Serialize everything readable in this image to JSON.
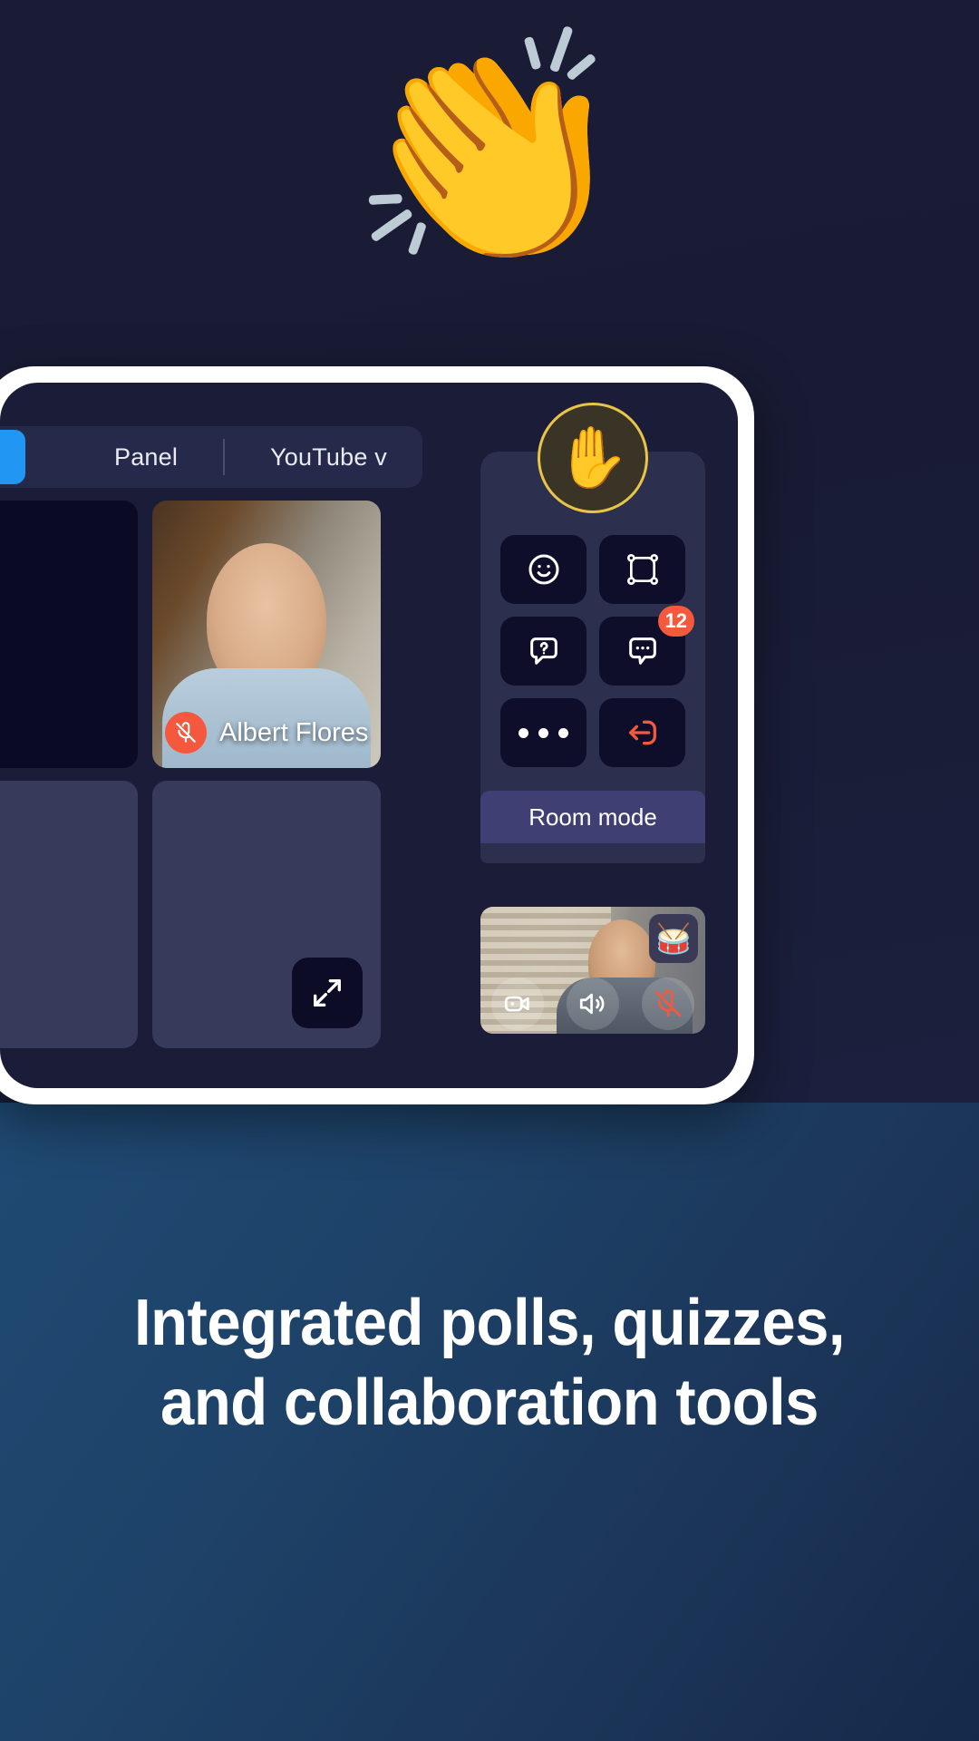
{
  "hero": {
    "reaction_emoji": "👏",
    "reaction_name": "clapping-hands"
  },
  "app": {
    "tabs": [
      {
        "label": "Panel"
      },
      {
        "label": "YouTube v"
      }
    ],
    "blue_button_label": "",
    "grid": {
      "tiles": [
        {
          "name": "",
          "type": "video",
          "muted": false
        },
        {
          "name": "Albert Flores",
          "type": "video",
          "muted": true
        },
        {
          "name": "",
          "type": "empty",
          "muted": false
        },
        {
          "name": "",
          "type": "empty",
          "muted": false
        }
      ],
      "expand_label": "expand"
    },
    "right_panel": {
      "raised_hand_emoji": "✋",
      "raised_hand_name": "raise-hand",
      "buttons": [
        {
          "name": "reactions",
          "icon": "smiley-icon",
          "badge": ""
        },
        {
          "name": "whiteboard",
          "icon": "frame-icon",
          "badge": ""
        },
        {
          "name": "questions",
          "icon": "question-bubble-icon",
          "badge": ""
        },
        {
          "name": "chat",
          "icon": "chat-bubble-icon",
          "badge": "12"
        },
        {
          "name": "more",
          "icon": "more-dots-icon",
          "badge": ""
        },
        {
          "name": "leave",
          "icon": "exit-icon",
          "badge": ""
        }
      ],
      "room_mode_label": "Room mode"
    },
    "self_view": {
      "camera_label": "camera",
      "speaker_label": "speaker",
      "mic_label": "microphone-muted",
      "drum_emoji": "🥁"
    }
  },
  "footer": {
    "headline_line1": "Integrated polls, quizzes,",
    "headline_line2": "and collaboration tools"
  },
  "colors": {
    "accent_blue": "#2196f3",
    "danger_red": "#f4593e",
    "hand_yellow": "#e8c547",
    "room_mode_purple": "#3f3f74",
    "panel_bg": "#2c2f4e",
    "screen_bg": "#1a1c38"
  }
}
